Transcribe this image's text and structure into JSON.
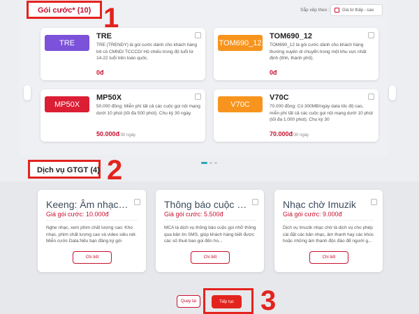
{
  "sections": {
    "packages_title": "Gói cước* (10)",
    "services_title": "Dịch vụ GTGT (4)"
  },
  "annotations": [
    "1",
    "2",
    "3"
  ],
  "sort": {
    "label": "Sắp xếp theo :",
    "selected": "Giá từ thấp - cao"
  },
  "packages": [
    {
      "badge": "TRE",
      "badge_color": "#7b52d9",
      "name": "TRE",
      "desc": "TRE (TRENDY) là gói cước dành cho khách hàng trẻ có CMND/ TCCCD/ Hộ chiếu trong độ tuổi từ 14-22 tuổi trên toàn quốc.",
      "price": "0đ",
      "unit": ""
    },
    {
      "badge": "TOM690_12",
      "badge_color": "#f7941d",
      "name": "TOM690_12",
      "desc": "TOM690_12 là gói cước dành cho khách hàng thường xuyên di chuyển trong một khu vực nhất định (tỉnh, thành phố).",
      "price": "0đ",
      "unit": ""
    },
    {
      "badge": "MP50X",
      "badge_color": "#dc1e35",
      "name": "MP50X",
      "desc": "50.000 đồng: Miễn phí tất cả các cuộc gọi nội mạng dưới 10 phút (tối đa 500 phút). Chu kỳ 30 ngày.",
      "price": "50.000đ",
      "unit": "/30 ngày"
    },
    {
      "badge": "V70C",
      "badge_color": "#f7941d",
      "name": "V70C",
      "desc": "70.000 đồng: Có 300MB/ngày data tốc độ cao, miễn phí tất cả các cuộc gọi nội mạng dưới 10 phút (tối đa 1.000 phút). Chu kỳ 30",
      "price": "70.000đ",
      "unit": "/30 ngày"
    }
  ],
  "services": [
    {
      "title": "Keeng: Âm nhạc trực tuyến",
      "price": "Giá gói cước: 10.000đ",
      "desc": "Nghe nhạc, xem phim chất lượng cao: Kho nhạc, phim chất lượng cao và video siêu nét. Miễn cước Data:Nếu bạn đăng ký gói",
      "button": "Chi tiết"
    },
    {
      "title": "Thông báo cuộc gọi nhỡ",
      "price": "Giá gói cước: 5.500đ",
      "desc": "MCA là dịch vụ thông báo cuộc gọi nhỡ thông qua bản tin SMS, giúp khách hàng biết được các số thuê bao gọi đến ho...",
      "button": "Chi tiết"
    },
    {
      "title": "Nhạc chờ Imuzik",
      "price": "Giá gói cước: 9.000đ",
      "desc": "Dịch vụ Imuzik nhạc chờ là dịch vụ cho phép cài đặt các bản nhạc, âm thanh hay các khúc hoặc những âm thanh độc đáo để người g...",
      "button": "Chi tiết"
    }
  ],
  "footer": {
    "back": "Quay lại",
    "next": "Tiếp tục"
  },
  "colors": {
    "accent": "#c8102e",
    "annotation": "#e3231e",
    "carousel_active": "#2aa7b0"
  }
}
